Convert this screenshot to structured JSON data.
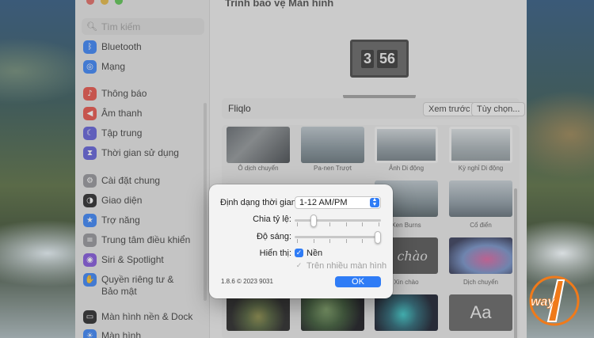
{
  "window": {
    "title": "Trình bảo vệ Màn hình"
  },
  "sidebar": {
    "search_placeholder": "Tìm kiếm",
    "items": [
      {
        "label": "Bluetooth",
        "icon": "bluetooth-icon",
        "color": "#2f7cf6"
      },
      {
        "label": "Mạng",
        "icon": "globe-icon",
        "color": "#2f7cf6"
      },
      {
        "label": "Thông báo",
        "icon": "bell-icon",
        "color": "#e5483f"
      },
      {
        "label": "Âm thanh",
        "icon": "speaker-icon",
        "color": "#e5483f"
      },
      {
        "label": "Tập trung",
        "icon": "moon-icon",
        "color": "#5856d6"
      },
      {
        "label": "Thời gian sử dụng",
        "icon": "hourglass-icon",
        "color": "#5856d6"
      },
      {
        "label": "Cài đặt chung",
        "icon": "gear-icon",
        "color": "#8e8e93"
      },
      {
        "label": "Giao diện",
        "icon": "appearance-icon",
        "color": "#1c1c1e"
      },
      {
        "label": "Trợ năng",
        "icon": "accessibility-icon",
        "color": "#2f7cf6"
      },
      {
        "label": "Trung tâm điều khiển",
        "icon": "control-center-icon",
        "color": "#8e8e93"
      },
      {
        "label": "Siri & Spotlight",
        "icon": "siri-icon",
        "color": "#7b4cd9"
      },
      {
        "label": "Quyền riêng tư &",
        "label2": "Bảo mật",
        "icon": "hand-icon",
        "color": "#2f7cf6"
      },
      {
        "label": "Màn hình nền & Dock",
        "icon": "dock-icon",
        "color": "#1c1c1e"
      },
      {
        "label": "Màn hình",
        "icon": "display-icon",
        "color": "#2f7cf6"
      }
    ]
  },
  "preview": {
    "digits": [
      "3",
      "56"
    ]
  },
  "source": {
    "name": "Fliqlo",
    "preview_button": "Xem trước",
    "options_button": "Tùy chọn..."
  },
  "savers": [
    {
      "label": "Ô dịch chuyển"
    },
    {
      "label": "Pa-nen Trượt"
    },
    {
      "label": "Ảnh Di động"
    },
    {
      "label": "Kỳ nghỉ Di động"
    },
    {
      "label": "Xen Burns"
    },
    {
      "label": "Cổ điển"
    },
    {
      "label": "Xin chào",
      "text": "n chào"
    },
    {
      "label": "Dịch chuyển"
    },
    {
      "label": "",
      "text": "Aa"
    }
  ],
  "dialog": {
    "time_format_label": "Định dạng thời gian:",
    "time_format_value": "1-12 AM/PM",
    "scale_label": "Chia tỷ lệ:",
    "brightness_label": "Độ sáng:",
    "scale_value": 0.2,
    "brightness_value": 1.0,
    "show_label": "Hiển thị:",
    "background_label": "Nền",
    "background_checked": true,
    "multi_display_label": "Trên nhiều màn hình",
    "multi_display_checked": true,
    "version": "1.8.6 © 2023 9031",
    "ok_label": "OK"
  },
  "logo": {
    "text": "way"
  },
  "colors": {
    "accent": "#2f7cf6",
    "logo_orange": "#f07a1a"
  }
}
